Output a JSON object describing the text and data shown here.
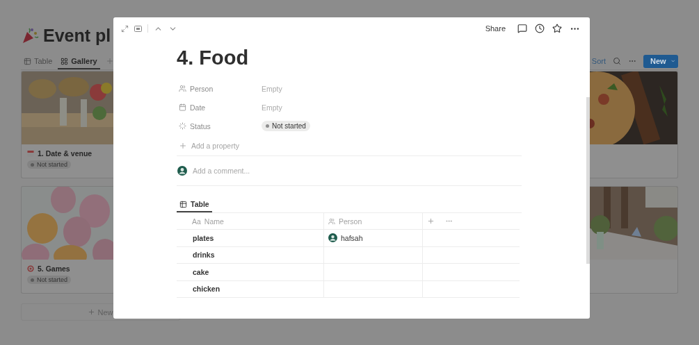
{
  "page": {
    "title": "Event pl",
    "views": [
      {
        "label": "Table",
        "selected": false
      },
      {
        "label": "Gallery",
        "selected": true
      }
    ],
    "toolbar": {
      "sort": "Sort",
      "new": "New"
    },
    "left_cards": [
      {
        "title": "1. Date & venue",
        "status": "Not started"
      },
      {
        "title": "5. Games",
        "status": "Not started"
      }
    ],
    "new_row": "New"
  },
  "modal": {
    "share": "Share",
    "title": "4. Food",
    "properties": [
      {
        "kind": "person",
        "label": "Person",
        "value": "Empty"
      },
      {
        "kind": "date",
        "label": "Date",
        "value": "Empty"
      },
      {
        "kind": "status",
        "label": "Status",
        "status": "Not started"
      }
    ],
    "add_property": "Add a property",
    "comment_placeholder": "Add a comment...",
    "table": {
      "view": {
        "label": "Table",
        "selected": true
      },
      "columns": [
        {
          "kind": "title",
          "prefix": "Aa",
          "label": "Name"
        },
        {
          "kind": "person",
          "label": "Person"
        }
      ],
      "rows": [
        {
          "name": "plates",
          "person": "hafsah"
        },
        {
          "name": "drinks"
        },
        {
          "name": "cake"
        },
        {
          "name": "chicken"
        }
      ]
    }
  }
}
